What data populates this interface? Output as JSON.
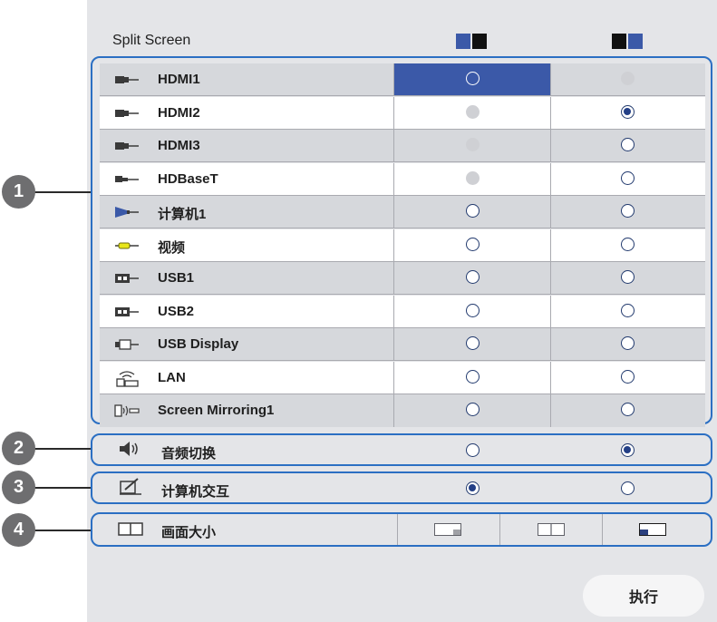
{
  "title": "Split Screen",
  "header_icons": [
    "split-left-icon",
    "split-right-icon"
  ],
  "sources": [
    {
      "label": "HDMI1",
      "icon": "hdmi-icon",
      "left": "selected-focused",
      "right": "disabled"
    },
    {
      "label": "HDMI2",
      "icon": "hdmi-icon",
      "left": "disabled",
      "right": "on"
    },
    {
      "label": "HDMI3",
      "icon": "hdmi-icon",
      "left": "disabled",
      "right": "off"
    },
    {
      "label": "HDBaseT",
      "icon": "hdbaset-icon",
      "left": "disabled",
      "right": "off"
    },
    {
      "label": "计算机1",
      "icon": "computer-vga-icon",
      "left": "off",
      "right": "off"
    },
    {
      "label": "视频",
      "icon": "video-rca-icon",
      "left": "off",
      "right": "off"
    },
    {
      "label": "USB1",
      "icon": "usb-icon",
      "left": "off",
      "right": "off"
    },
    {
      "label": "USB2",
      "icon": "usb-icon",
      "left": "off",
      "right": "off"
    },
    {
      "label": "USB Display",
      "icon": "usb-display-icon",
      "left": "off",
      "right": "off"
    },
    {
      "label": "LAN",
      "icon": "lan-icon",
      "left": "off",
      "right": "off"
    },
    {
      "label": "Screen Mirroring1",
      "icon": "screen-mirroring-icon",
      "left": "off",
      "right": "off"
    }
  ],
  "audio": {
    "label": "音频切换",
    "icon": "speaker-icon",
    "left": "off",
    "right": "on"
  },
  "interactive": {
    "label": "计算机交互",
    "icon": "pen-icon",
    "left": "on",
    "right": "off"
  },
  "screen_size": {
    "label": "画面大小",
    "icon": "screen-size-icon",
    "options": [
      "size-left-large-icon",
      "size-equal-icon",
      "size-right-large-icon"
    ]
  },
  "callouts": [
    "1",
    "2",
    "3",
    "4"
  ],
  "execute_label": "执行",
  "colors": {
    "accent": "#3b59a8",
    "group_border": "#2b6fc3",
    "panel_bg": "#e4e5e8"
  }
}
